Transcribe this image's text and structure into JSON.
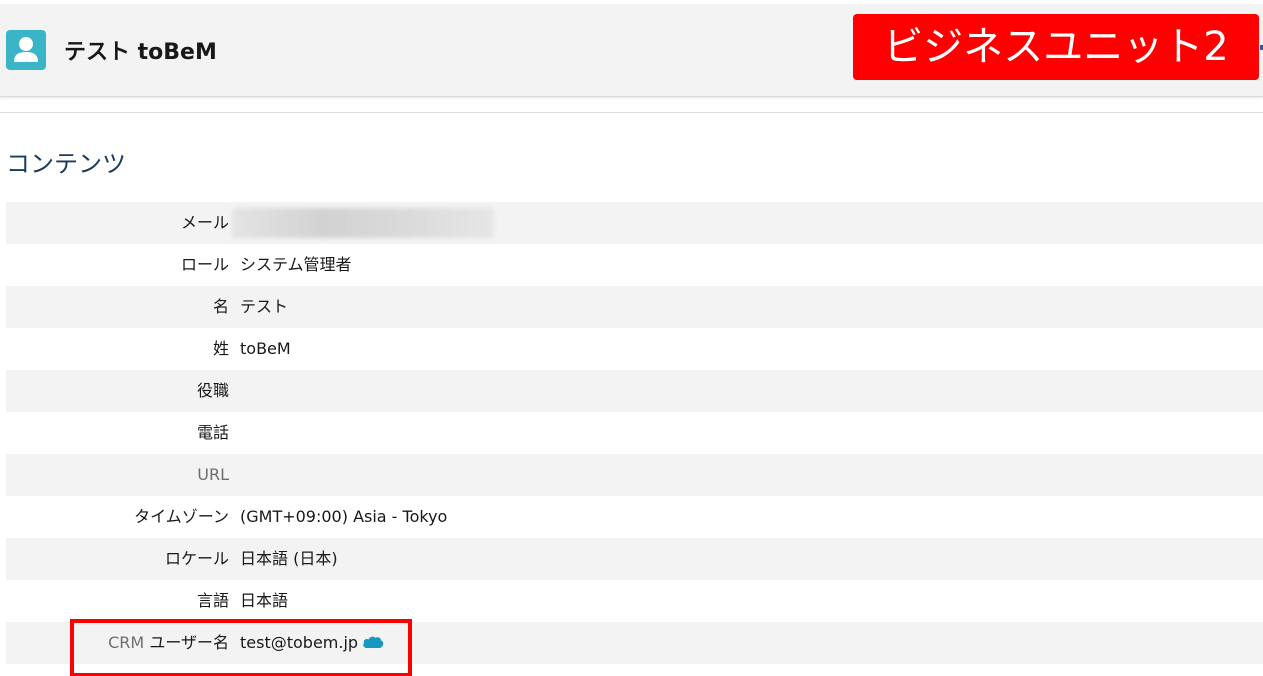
{
  "header": {
    "title": "テスト toBeM",
    "badge": "ビジネスユニット2"
  },
  "section": {
    "title": "コンテンツ"
  },
  "fields": [
    {
      "label": "メール",
      "value": "",
      "blurred": true
    },
    {
      "label": "ロール",
      "value": "システム管理者"
    },
    {
      "label": "名",
      "value": "テスト"
    },
    {
      "label": "姓",
      "value": "toBeM"
    },
    {
      "label": "役職",
      "value": ""
    },
    {
      "label": "電話",
      "value": ""
    },
    {
      "label": "URL",
      "value": ""
    },
    {
      "label": "タイムゾーン",
      "value": "(GMT+09:00) Asia - Tokyo"
    },
    {
      "label": "ロケール",
      "value": "日本語 (日本)"
    },
    {
      "label": "言語",
      "value": "日本語"
    },
    {
      "label_prefix": "CRM",
      "label": "ユーザー名",
      "value": "test@tobem.jp"
    }
  ],
  "colors": {
    "badge_bg": "#ff0000",
    "icon_bg": "#3ab5c8",
    "cloud": "#1798c1",
    "row_alt": "#f3f3f3"
  },
  "icons": {
    "user": "user-avatar-icon",
    "cloud": "salesforce-cloud-icon"
  }
}
